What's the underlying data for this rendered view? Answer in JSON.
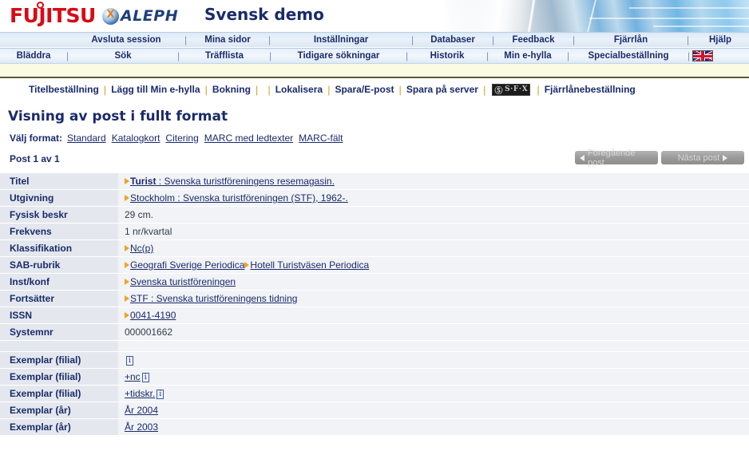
{
  "header": {
    "brand_logo": "FUJITSU",
    "product_logo": "ALEPH",
    "site_title": "Svensk demo",
    "brand_color": "#d60b15",
    "title_color": "#1a2a6b"
  },
  "nav_row1": [
    {
      "label": "Avsluta session"
    },
    {
      "label": "Mina sidor"
    },
    {
      "label": "Inställningar"
    },
    {
      "label": "Databaser"
    },
    {
      "label": "Feedback"
    },
    {
      "label": "Fjärrlån"
    },
    {
      "label": "Hjälp"
    }
  ],
  "nav_row2": [
    {
      "label": "Bläddra"
    },
    {
      "label": "Sök"
    },
    {
      "label": "Träfflista"
    },
    {
      "label": "Tidigare sökningar"
    },
    {
      "label": "Historik"
    },
    {
      "label": "Min e-hylla"
    },
    {
      "label": "Specialbeställning"
    }
  ],
  "nav_separator": "|",
  "language_flag": "union-jack-flag",
  "toolbar": {
    "items": [
      {
        "label": "Titelbeställning",
        "type": "link"
      },
      {
        "label": "Lägg till Min e-hylla",
        "type": "link"
      },
      {
        "label": "Bokning",
        "type": "link"
      },
      {
        "label": "Lokalisera",
        "type": "link"
      },
      {
        "label": "Spara/E-post",
        "type": "link"
      },
      {
        "label": "Spara på server",
        "type": "link"
      },
      {
        "label": "S·F·X",
        "type": "sfx-button"
      },
      {
        "label": "Fjärrlånebeställning",
        "type": "link"
      }
    ],
    "separator": "|",
    "sfx_label": "S·F·X"
  },
  "page_title": "Visning av post i fullt format",
  "format": {
    "label": "Välj format:",
    "options": [
      "Standard",
      "Katalogkort",
      "Citering",
      "MARC med ledtexter",
      "MARC-fält"
    ]
  },
  "record_nav": {
    "count_text": "Post 1 av 1",
    "prev_label": "Föregående post",
    "next_label": "Nästa post",
    "prev_disabled": true,
    "next_disabled": true
  },
  "record": {
    "rows": [
      {
        "label": "Titel",
        "segments": [
          {
            "bullet": true,
            "link": true,
            "bold_prefix": "Turist",
            "text": " : Svenska turistföreningens resemagasin."
          }
        ]
      },
      {
        "label": "Utgivning",
        "segments": [
          {
            "bullet": true,
            "link": true,
            "text": "Stockholm : Svenska turistföreningen (STF), 1962-."
          }
        ]
      },
      {
        "label": "Fysisk beskr",
        "segments": [
          {
            "bullet": false,
            "link": false,
            "text": "29 cm."
          }
        ]
      },
      {
        "label": "Frekvens",
        "segments": [
          {
            "bullet": false,
            "link": false,
            "text": "1 nr/kvartal"
          }
        ]
      },
      {
        "label": "Klassifikation",
        "segments": [
          {
            "bullet": true,
            "link": true,
            "text": "Nc(p)"
          }
        ]
      },
      {
        "label": "SAB-rubrik",
        "segments": [
          {
            "bullet": true,
            "link": true,
            "text": "Geografi Sverige Periodica"
          },
          {
            "bullet": true,
            "link": true,
            "text": "Hotell Turistväsen Periodica"
          }
        ]
      },
      {
        "label": "Inst/konf",
        "segments": [
          {
            "bullet": true,
            "link": true,
            "text": "Svenska turistföreningen"
          }
        ]
      },
      {
        "label": "Fortsätter",
        "segments": [
          {
            "bullet": true,
            "link": true,
            "text": "STF : Svenska turistföreningens tidning"
          }
        ]
      },
      {
        "label": "ISSN",
        "segments": [
          {
            "bullet": true,
            "link": true,
            "text": "0041-4190"
          }
        ]
      },
      {
        "label": "Systemnr",
        "segments": [
          {
            "bullet": false,
            "link": false,
            "text": "000001662"
          }
        ]
      },
      {
        "label": "",
        "spacer": true,
        "segments": []
      },
      {
        "label": "Exemplar (filial)",
        "segments": [
          {
            "bullet": false,
            "link": false,
            "text": "",
            "info_icon": true
          }
        ]
      },
      {
        "label": "Exemplar (filial)",
        "segments": [
          {
            "bullet": false,
            "link": true,
            "text": "+nc",
            "info_icon": true
          }
        ]
      },
      {
        "label": "Exemplar (filial)",
        "segments": [
          {
            "bullet": false,
            "link": true,
            "text": "+tidskr.",
            "info_icon": true
          }
        ]
      },
      {
        "label": "Exemplar (år)",
        "segments": [
          {
            "bullet": false,
            "link": true,
            "text": "År 2004"
          }
        ]
      },
      {
        "label": "Exemplar (år)",
        "segments": [
          {
            "bullet": false,
            "link": true,
            "text": "År 2003"
          }
        ]
      }
    ]
  },
  "colors": {
    "link": "#1a2a6b",
    "bullet": "#f0a21e",
    "label_cell_bg": "#e4e8ee",
    "value_cell_bg": "#f1f3f6",
    "yellow_band": "#fbfbe4"
  }
}
